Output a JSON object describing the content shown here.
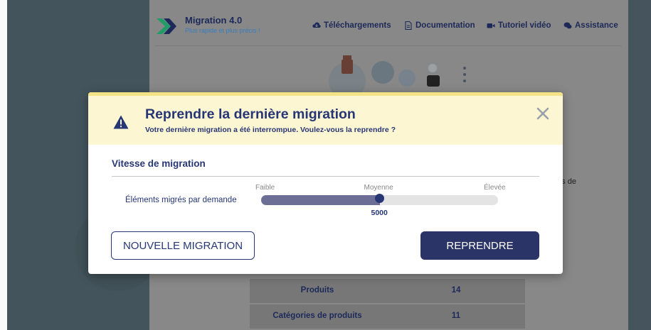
{
  "header": {
    "brand": "Migration 4.0",
    "tagline": "Plus rapide et plus précis !",
    "nav": [
      {
        "label": "Téléchargements",
        "icon": "cloud-download-icon"
      },
      {
        "label": "Documentation",
        "icon": "document-icon"
      },
      {
        "label": "Tutoriel vidéo",
        "icon": "video-camera-icon"
      },
      {
        "label": "Assistance",
        "icon": "chat-bubbles-icon"
      }
    ]
  },
  "background": {
    "side_text": "tés de",
    "table_rows": [
      {
        "label": "Produits",
        "value": "14"
      },
      {
        "label": "Catégories de produits",
        "value": "11"
      }
    ]
  },
  "modal": {
    "title": "Reprendre la dernière migration",
    "subtitle": "Votre dernière migration a été interrompue. Voulez-vous la reprendre ?",
    "close_icon": "close-icon",
    "warning_icon": "warning-triangle-icon",
    "section_title": "Vitesse de migration",
    "slider": {
      "label": "Éléments migrés par demande",
      "ticks": [
        "Faible",
        "Moyenne",
        "Élevée"
      ],
      "value": "5000",
      "level": 0.5
    },
    "buttons": {
      "new_migration": "NOUVELLE MIGRATION",
      "resume": "REPRENDRE"
    }
  },
  "colors": {
    "primary": "#273775",
    "banner": "#fdf6d3",
    "slider_fill": "#6d6e95",
    "accent_blue": "#3b7fbf"
  }
}
